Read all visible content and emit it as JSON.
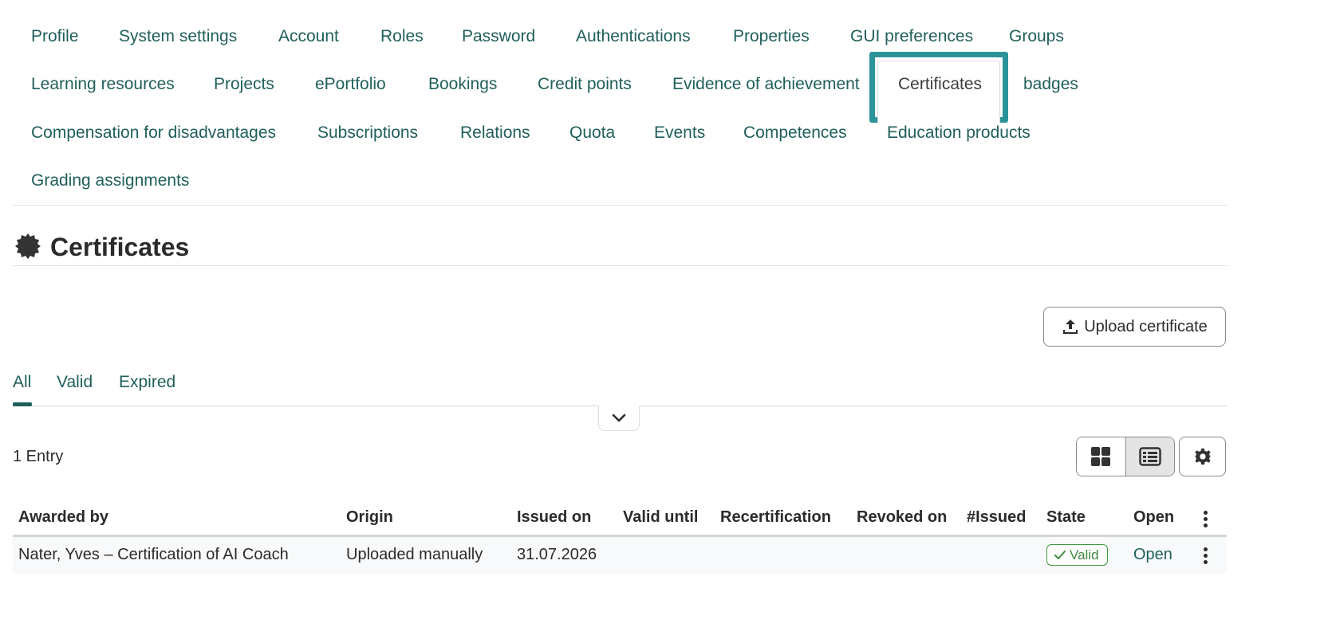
{
  "nav": {
    "tabs": [
      "Profile",
      "System settings",
      "Account",
      "Roles",
      "Password",
      "Authentications",
      "Properties",
      "GUI preferences",
      "Groups",
      "Learning resources",
      "Projects",
      "ePortfolio",
      "Bookings",
      "Credit points",
      "Evidence of achievement",
      "Certificates",
      "badges",
      "Compensation for disadvantages",
      "Subscriptions",
      "Relations",
      "Quota",
      "Events",
      "Competences",
      "Education products",
      "Grading assignments"
    ],
    "active": "Certificates"
  },
  "page": {
    "title": "Certificates",
    "icon": "certificate-seal-icon"
  },
  "toolbar": {
    "upload_label": "Upload certificate",
    "upload_icon": "upload-icon"
  },
  "filter_tabs": {
    "items": [
      "All",
      "Valid",
      "Expired"
    ],
    "active": "All"
  },
  "list": {
    "entry_count": "1 Entry",
    "view_modes": [
      "grid-view-icon",
      "list-view-icon"
    ],
    "active_view": "list-view-icon",
    "settings_icon": "gear-icon"
  },
  "table": {
    "headers": {
      "awarded_by": "Awarded by",
      "origin": "Origin",
      "issued_on": "Issued on",
      "valid_until": "Valid until",
      "recertification": "Recertification",
      "revoked_on": "Revoked on",
      "issued_count": "#Issued",
      "state": "State",
      "open": "Open"
    },
    "rows": [
      {
        "awarded_by": "Nater, Yves – Certification of AI Coach",
        "origin": "Uploaded manually",
        "issued_on": "31.07.2026",
        "valid_until": "",
        "recertification": "",
        "revoked_on": "",
        "issued_count": "",
        "state": "Valid",
        "open": "Open"
      }
    ]
  },
  "colors": {
    "link": "#1f5f5b",
    "active_highlight": "#2b9399",
    "valid_badge": "#3f9a3f"
  }
}
